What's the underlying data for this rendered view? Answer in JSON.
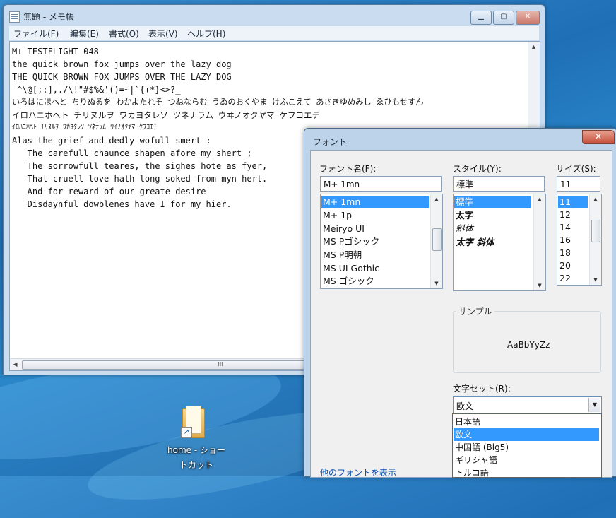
{
  "notepad": {
    "title": "無題 - メモ帳",
    "menu": [
      "ファイル(F)",
      "編集(E)",
      "書式(O)",
      "表示(V)",
      "ヘルプ(H)"
    ],
    "lines": [
      "M+ TESTFLIGHT 048",
      "the quick brown fox jumps over the lazy dog",
      "THE QUICK BROWN FOX JUMPS OVER THE LAZY DOG",
      "-^\\@[;:],./\\!\"#$%&'()=~|`{+*}<>?_",
      "いろはにほへと ちりぬるを わかよたれそ つねならむ うゐのおくやま けふこえて あさきゆめみし ゑひもせすん",
      "イロハニホヘト チリヌルヲ ワカヨタレソ ツネナラム ウヰノオクヤマ ケフコエテ",
      "ｲﾛﾊﾆﾎﾍﾄ ﾁﾘﾇﾙｦ ﾜｶﾖﾀﾚｿ ﾂﾈﾅﾗﾑ ｳｲﾉｵｸﾔﾏ ｹﾌｺｴﾃ",
      "Alas the grief and dedly wofull smert :",
      "   The carefull chaunce shapen afore my shert ;",
      "   The sorrowfull teares, the sighes hote as fyer,",
      "   That cruell love hath long soked from myn hert.",
      "   And for reward of our greate desire",
      "   Disdaynful dowblenes have I for my hier."
    ],
    "hscroll_grip": "III"
  },
  "desktop": {
    "shortcut_label_1": "home - ショー",
    "shortcut_label_2": "トカット"
  },
  "dialog": {
    "title": "フォント",
    "close": "✕",
    "font_name_label": "フォント名(F):",
    "font_name_value": "M+ 1mn",
    "font_list": [
      "M+ 1mn",
      "M+ 1p",
      "Meiryo UI",
      "MS Pゴシック",
      "MS P明朝",
      "MS UI Gothic",
      "MS ゴシック"
    ],
    "style_label": "スタイル(Y):",
    "style_value": "標準",
    "style_list": [
      "標準",
      "太字",
      "斜体",
      "太字 斜体"
    ],
    "size_label": "サイズ(S):",
    "size_value": "11",
    "size_list": [
      "11",
      "12",
      "14",
      "16",
      "18",
      "20",
      "22"
    ],
    "sample_label": "サンプル",
    "sample_text": "AaBbYyZz",
    "charset_label": "文字セット(R):",
    "charset_value": "欧文",
    "charset_options": [
      "日本語",
      "欧文",
      "中国語 (Big5)",
      "ギリシャ語",
      "トルコ語"
    ],
    "more_fonts_link": "他のフォントを表示"
  }
}
